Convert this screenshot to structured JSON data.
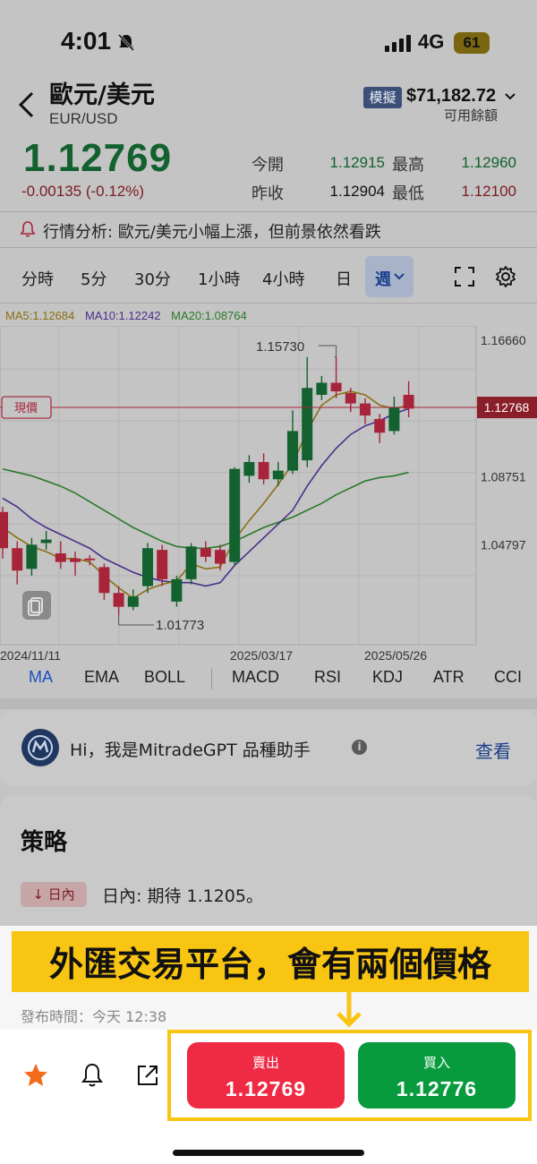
{
  "status_bar": {
    "time": "4:01",
    "network": "4G",
    "battery": "61"
  },
  "header": {
    "title": "歐元/美元",
    "code": "EUR/USD",
    "mode_badge": "模擬",
    "balance": "$71,182.72",
    "balance_label": "可用餘額"
  },
  "quote": {
    "price": "1.12769",
    "change": "-0.00135 (-0.12%)",
    "open_label": "今開",
    "open": "1.12915",
    "high_label": "最高",
    "high": "1.12960",
    "prev_close_label": "昨收",
    "prev_close": "1.12904",
    "low_label": "最低",
    "low": "1.12100"
  },
  "analysis": "行情分析: 歐元/美元小幅上漲，但前景依然看跌",
  "timeframes": [
    "分時",
    "5分",
    "30分",
    "1小時",
    "4小時",
    "日",
    "週"
  ],
  "active_timeframe": "週",
  "ma_legend": {
    "ma5": "MA5:1.12684",
    "ma10": "MA10:1.12242",
    "ma20": "MA20:1.08764"
  },
  "chart_data": {
    "type": "candlestick",
    "y_ticks": [
      "1.16660",
      "1.08751",
      "1.04797"
    ],
    "current_price_tag": "現價",
    "current_price": "1.12768",
    "annotation_high": "1.15730",
    "annotation_low": "1.01773",
    "x_labels": [
      "2024/11/11",
      "2025/03/17",
      "2025/05/26"
    ],
    "ylim": [
      0.99,
      1.175
    ],
    "candles": [
      {
        "o": 1.067,
        "c": 1.046,
        "h": 1.07,
        "l": 1.04
      },
      {
        "o": 1.046,
        "c": 1.033,
        "h": 1.05,
        "l": 1.025
      },
      {
        "o": 1.034,
        "c": 1.048,
        "h": 1.052,
        "l": 1.03
      },
      {
        "o": 1.049,
        "c": 1.051,
        "h": 1.056,
        "l": 1.045
      },
      {
        "o": 1.043,
        "c": 1.038,
        "h": 1.05,
        "l": 1.034
      },
      {
        "o": 1.04,
        "c": 1.038,
        "h": 1.044,
        "l": 1.03
      },
      {
        "o": 1.04,
        "c": 1.039,
        "h": 1.042,
        "l": 1.036
      },
      {
        "o": 1.035,
        "c": 1.02,
        "h": 1.037,
        "l": 1.016
      },
      {
        "o": 1.02,
        "c": 1.012,
        "h": 1.024,
        "l": 1.007
      },
      {
        "o": 1.012,
        "c": 1.018,
        "h": 1.022,
        "l": 1.01
      },
      {
        "o": 1.024,
        "c": 1.046,
        "h": 1.049,
        "l": 1.02
      },
      {
        "o": 1.045,
        "c": 1.028,
        "h": 1.048,
        "l": 1.024
      },
      {
        "o": 1.015,
        "c": 1.028,
        "h": 1.03,
        "l": 1.012
      },
      {
        "o": 1.028,
        "c": 1.047,
        "h": 1.049,
        "l": 1.025
      },
      {
        "o": 1.046,
        "c": 1.041,
        "h": 1.05,
        "l": 1.038
      },
      {
        "o": 1.045,
        "c": 1.037,
        "h": 1.048,
        "l": 1.033
      },
      {
        "o": 1.038,
        "c": 1.092,
        "h": 1.093,
        "l": 1.036
      },
      {
        "o": 1.088,
        "c": 1.096,
        "h": 1.1,
        "l": 1.084
      },
      {
        "o": 1.096,
        "c": 1.086,
        "h": 1.101,
        "l": 1.083
      },
      {
        "o": 1.086,
        "c": 1.091,
        "h": 1.096,
        "l": 1.082
      },
      {
        "o": 1.091,
        "c": 1.114,
        "h": 1.126,
        "l": 1.089
      },
      {
        "o": 1.097,
        "c": 1.139,
        "h": 1.157,
        "l": 1.093
      },
      {
        "o": 1.135,
        "c": 1.142,
        "h": 1.146,
        "l": 1.132
      },
      {
        "o": 1.142,
        "c": 1.137,
        "h": 1.157,
        "l": 1.133
      },
      {
        "o": 1.136,
        "c": 1.13,
        "h": 1.139,
        "l": 1.125
      },
      {
        "o": 1.13,
        "c": 1.123,
        "h": 1.133,
        "l": 1.118
      },
      {
        "o": 1.121,
        "c": 1.113,
        "h": 1.124,
        "l": 1.107
      },
      {
        "o": 1.114,
        "c": 1.128,
        "h": 1.134,
        "l": 1.112
      },
      {
        "o": 1.135,
        "c": 1.127,
        "h": 1.143,
        "l": 1.122
      }
    ],
    "ma5": [
      1.058,
      1.052,
      1.047,
      1.044,
      1.04,
      1.04,
      1.038,
      1.03,
      1.023,
      1.017,
      1.022,
      1.025,
      1.027,
      1.037,
      1.034,
      1.035,
      1.051,
      1.062,
      1.072,
      1.083,
      1.095,
      1.114,
      1.129,
      1.135,
      1.137,
      1.135,
      1.129,
      1.127,
      1.129
    ],
    "ma10": [
      1.075,
      1.07,
      1.063,
      1.058,
      1.054,
      1.05,
      1.046,
      1.04,
      1.036,
      1.032,
      1.029,
      1.027,
      1.026,
      1.026,
      1.024,
      1.026,
      1.036,
      1.044,
      1.052,
      1.06,
      1.068,
      1.082,
      1.094,
      1.104,
      1.112,
      1.117,
      1.12,
      1.124,
      1.127
    ],
    "ma20": [
      1.092,
      1.09,
      1.088,
      1.085,
      1.082,
      1.078,
      1.073,
      1.068,
      1.063,
      1.058,
      1.054,
      1.05,
      1.047,
      1.046,
      1.046,
      1.047,
      1.05,
      1.054,
      1.058,
      1.061,
      1.064,
      1.068,
      1.072,
      1.077,
      1.081,
      1.085,
      1.087,
      1.088,
      1.09
    ]
  },
  "indicators": [
    "MA",
    "EMA",
    "BOLL",
    "MACD",
    "RSI",
    "KDJ",
    "ATR",
    "CCI"
  ],
  "active_indicator": "MA",
  "gpt_card": {
    "text": "Hi，我是MitradeGPT 品種助手",
    "view": "查看"
  },
  "strategy": {
    "title": "策略",
    "tag": "↓ 日內",
    "text": "日內: 期待 1.1205。",
    "publish_time": "發布時間：今天 12:38"
  },
  "banner": "外匯交易平台，會有兩個價格",
  "trade": {
    "sell_label": "賣出",
    "sell_price": "1.12769",
    "buy_label": "買入",
    "buy_price": "1.12776"
  },
  "colors": {
    "up": "#12612e",
    "down": "#a8243a",
    "ma5": "#8a6f12",
    "ma10": "#4a2f8a",
    "ma20": "#2a7a2a",
    "sell": "#ef2a44",
    "buy": "#089b3e",
    "banner": "#f9c513"
  }
}
